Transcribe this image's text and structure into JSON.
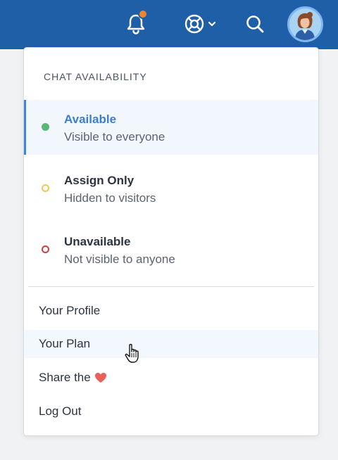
{
  "topbar": {
    "background": "#1f5fa8",
    "notification_dot_color": "#f0862a",
    "icons": [
      "bell-icon",
      "help-lifebuoy-icon",
      "chevron-down-icon",
      "search-icon"
    ]
  },
  "menu": {
    "section_title": "CHAT AVAILABILITY",
    "statuses": [
      {
        "label": "Available",
        "sub": "Visible to everyone",
        "color": "#5ab776",
        "active": true
      },
      {
        "label": "Assign Only",
        "sub": "Hidden to visitors",
        "color": "#f2c94c",
        "active": false
      },
      {
        "label": "Unavailable",
        "sub": "Not visible to anyone",
        "color": "#d23c3c",
        "active": false
      }
    ],
    "items": [
      {
        "label": "Your Profile"
      },
      {
        "label": "Your Plan",
        "hover": true
      },
      {
        "label": "Share the",
        "icon": "heart-icon",
        "icon_color": "#e9615a"
      },
      {
        "label": "Log Out"
      }
    ]
  }
}
